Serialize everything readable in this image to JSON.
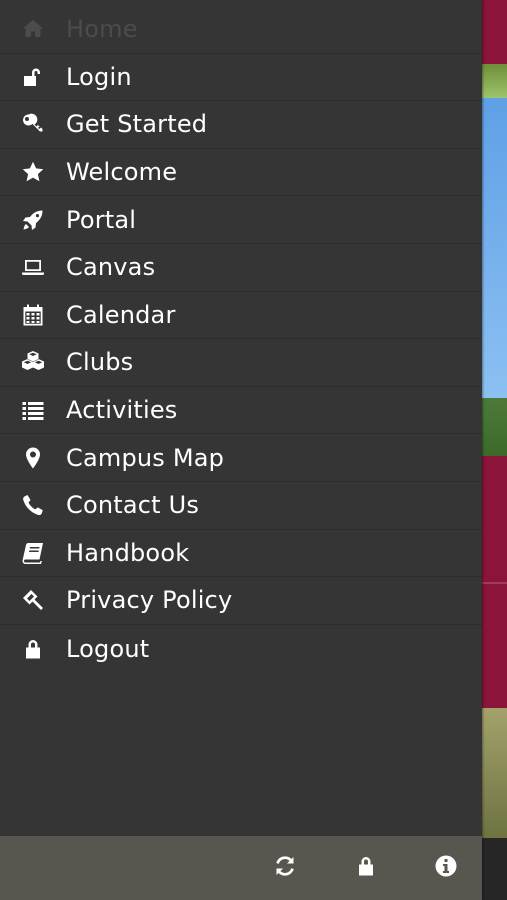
{
  "menu": {
    "items": [
      {
        "label": "Home",
        "icon": "home-icon"
      },
      {
        "label": "Login",
        "icon": "unlock-icon"
      },
      {
        "label": "Get Started",
        "icon": "key-icon"
      },
      {
        "label": "Welcome",
        "icon": "star-icon"
      },
      {
        "label": "Portal",
        "icon": "rocket-icon"
      },
      {
        "label": "Canvas",
        "icon": "laptop-icon"
      },
      {
        "label": "Calendar",
        "icon": "calendar-icon"
      },
      {
        "label": "Clubs",
        "icon": "cubes-icon"
      },
      {
        "label": "Activities",
        "icon": "list-icon"
      },
      {
        "label": "Campus Map",
        "icon": "map-marker-icon"
      },
      {
        "label": "Contact Us",
        "icon": "phone-icon"
      },
      {
        "label": "Handbook",
        "icon": "book-icon"
      },
      {
        "label": "Privacy Policy",
        "icon": "gavel-icon"
      },
      {
        "label": "Logout",
        "icon": "lock-icon"
      }
    ]
  },
  "toolbar": {
    "buttons": [
      "refresh-icon",
      "lock-icon",
      "info-icon"
    ]
  },
  "colors": {
    "drawer_bg": "#353535",
    "toolbar_bg": "#595650",
    "accent_maroon": "#8a1538",
    "text": "#ffffff",
    "disabled_text": "#4c4c4c"
  }
}
